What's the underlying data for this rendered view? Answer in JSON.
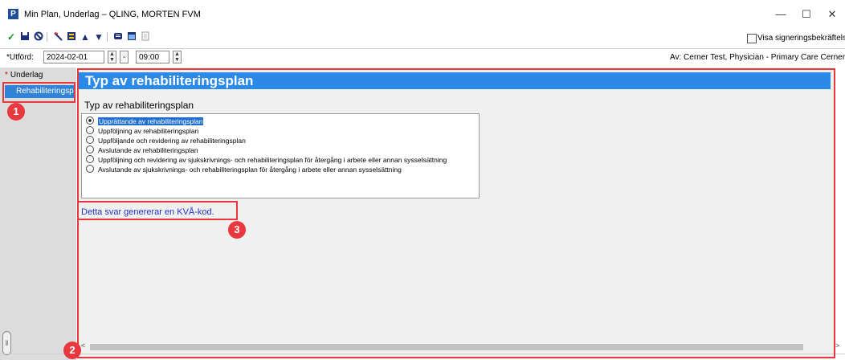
{
  "window": {
    "title": "Min Plan, Underlag – QLING, MORTEN FVM",
    "minimize": "—",
    "maximize": "☐",
    "close": "✕"
  },
  "toolbar": {
    "icons": [
      "check-icon",
      "save-icon",
      "cancel-icon",
      "pen-icon",
      "form-icon",
      "up-arrow-icon",
      "down-arrow-icon",
      "comment-icon",
      "calendar-icon",
      "document-icon"
    ],
    "sign_label": "Visa signeringsbekräftelse"
  },
  "datetime": {
    "performed_label": "*Utförd:",
    "date_value": "2024-02-01",
    "time_value": "09:00",
    "author_label": "Av:  Cerner Test, Physician - Primary Care Cerner"
  },
  "nav": {
    "items": [
      {
        "label": "Underlag",
        "required_mark": "*"
      },
      {
        "label": "Rehabiliteringsplan"
      }
    ]
  },
  "panel": {
    "header": "Typ av rehabiliteringsplan",
    "section_label": "Typ av rehabiliteringsplan",
    "options": [
      "Upprättande av rehabiliteringsplan",
      "Uppföljning av rehabiliteringsplan",
      "Uppföljande och revidering av rehabiliteringsplan",
      "Avslutande av rehabiliteringsplan",
      "Uppföljning och revidering av sjukskrivnings- och rehabiliteringsplan för återgång i arbete eller annan sysselsättning",
      "Avslutande av sjukskrivnings- och rehabiliteringsplan för återgång i arbete eller annan sysselsättning"
    ],
    "selected_index": 0,
    "kva_note": "Detta svar genererar en KVÅ-kod."
  },
  "annotations": {
    "badge1": "1",
    "badge2": "2",
    "badge3": "3"
  },
  "colors": {
    "accent_blue": "#2b8ae8",
    "annotation_red": "#e8383d",
    "link_blue": "#2233cc"
  }
}
